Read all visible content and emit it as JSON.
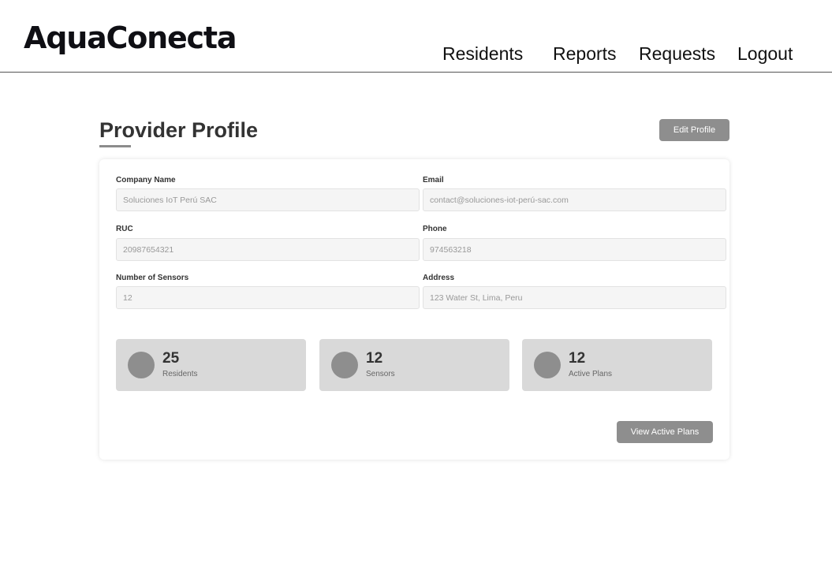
{
  "app": {
    "logo": "AquaConecta"
  },
  "nav": {
    "residents": "Residents",
    "reports": "Reports",
    "requests": "Requests",
    "logout": "Logout"
  },
  "page": {
    "title": "Provider Profile",
    "edit_button": "Edit Profile"
  },
  "profile": {
    "company_name": {
      "label": "Company Name",
      "value": "Soluciones IoT Perú SAC"
    },
    "email": {
      "label": "Email",
      "value": "contact@soluciones-iot-perú-sac.com"
    },
    "ruc": {
      "label": "RUC",
      "value": "20987654321"
    },
    "phone": {
      "label": "Phone",
      "value": "974563218"
    },
    "sensors": {
      "label": "Number of Sensors",
      "value": "12"
    },
    "address": {
      "label": "Address",
      "value": "123 Water St, Lima, Peru"
    }
  },
  "stats": [
    {
      "value": "25",
      "label": "Residents"
    },
    {
      "value": "12",
      "label": "Sensors"
    },
    {
      "value": "12",
      "label": "Active Plans"
    }
  ],
  "actions": {
    "view_active_plans": "View Active Plans"
  },
  "colors": {
    "button_bg": "#8e8e8e",
    "stat_bg": "#d9d9d9",
    "input_bg": "#f5f5f5"
  }
}
